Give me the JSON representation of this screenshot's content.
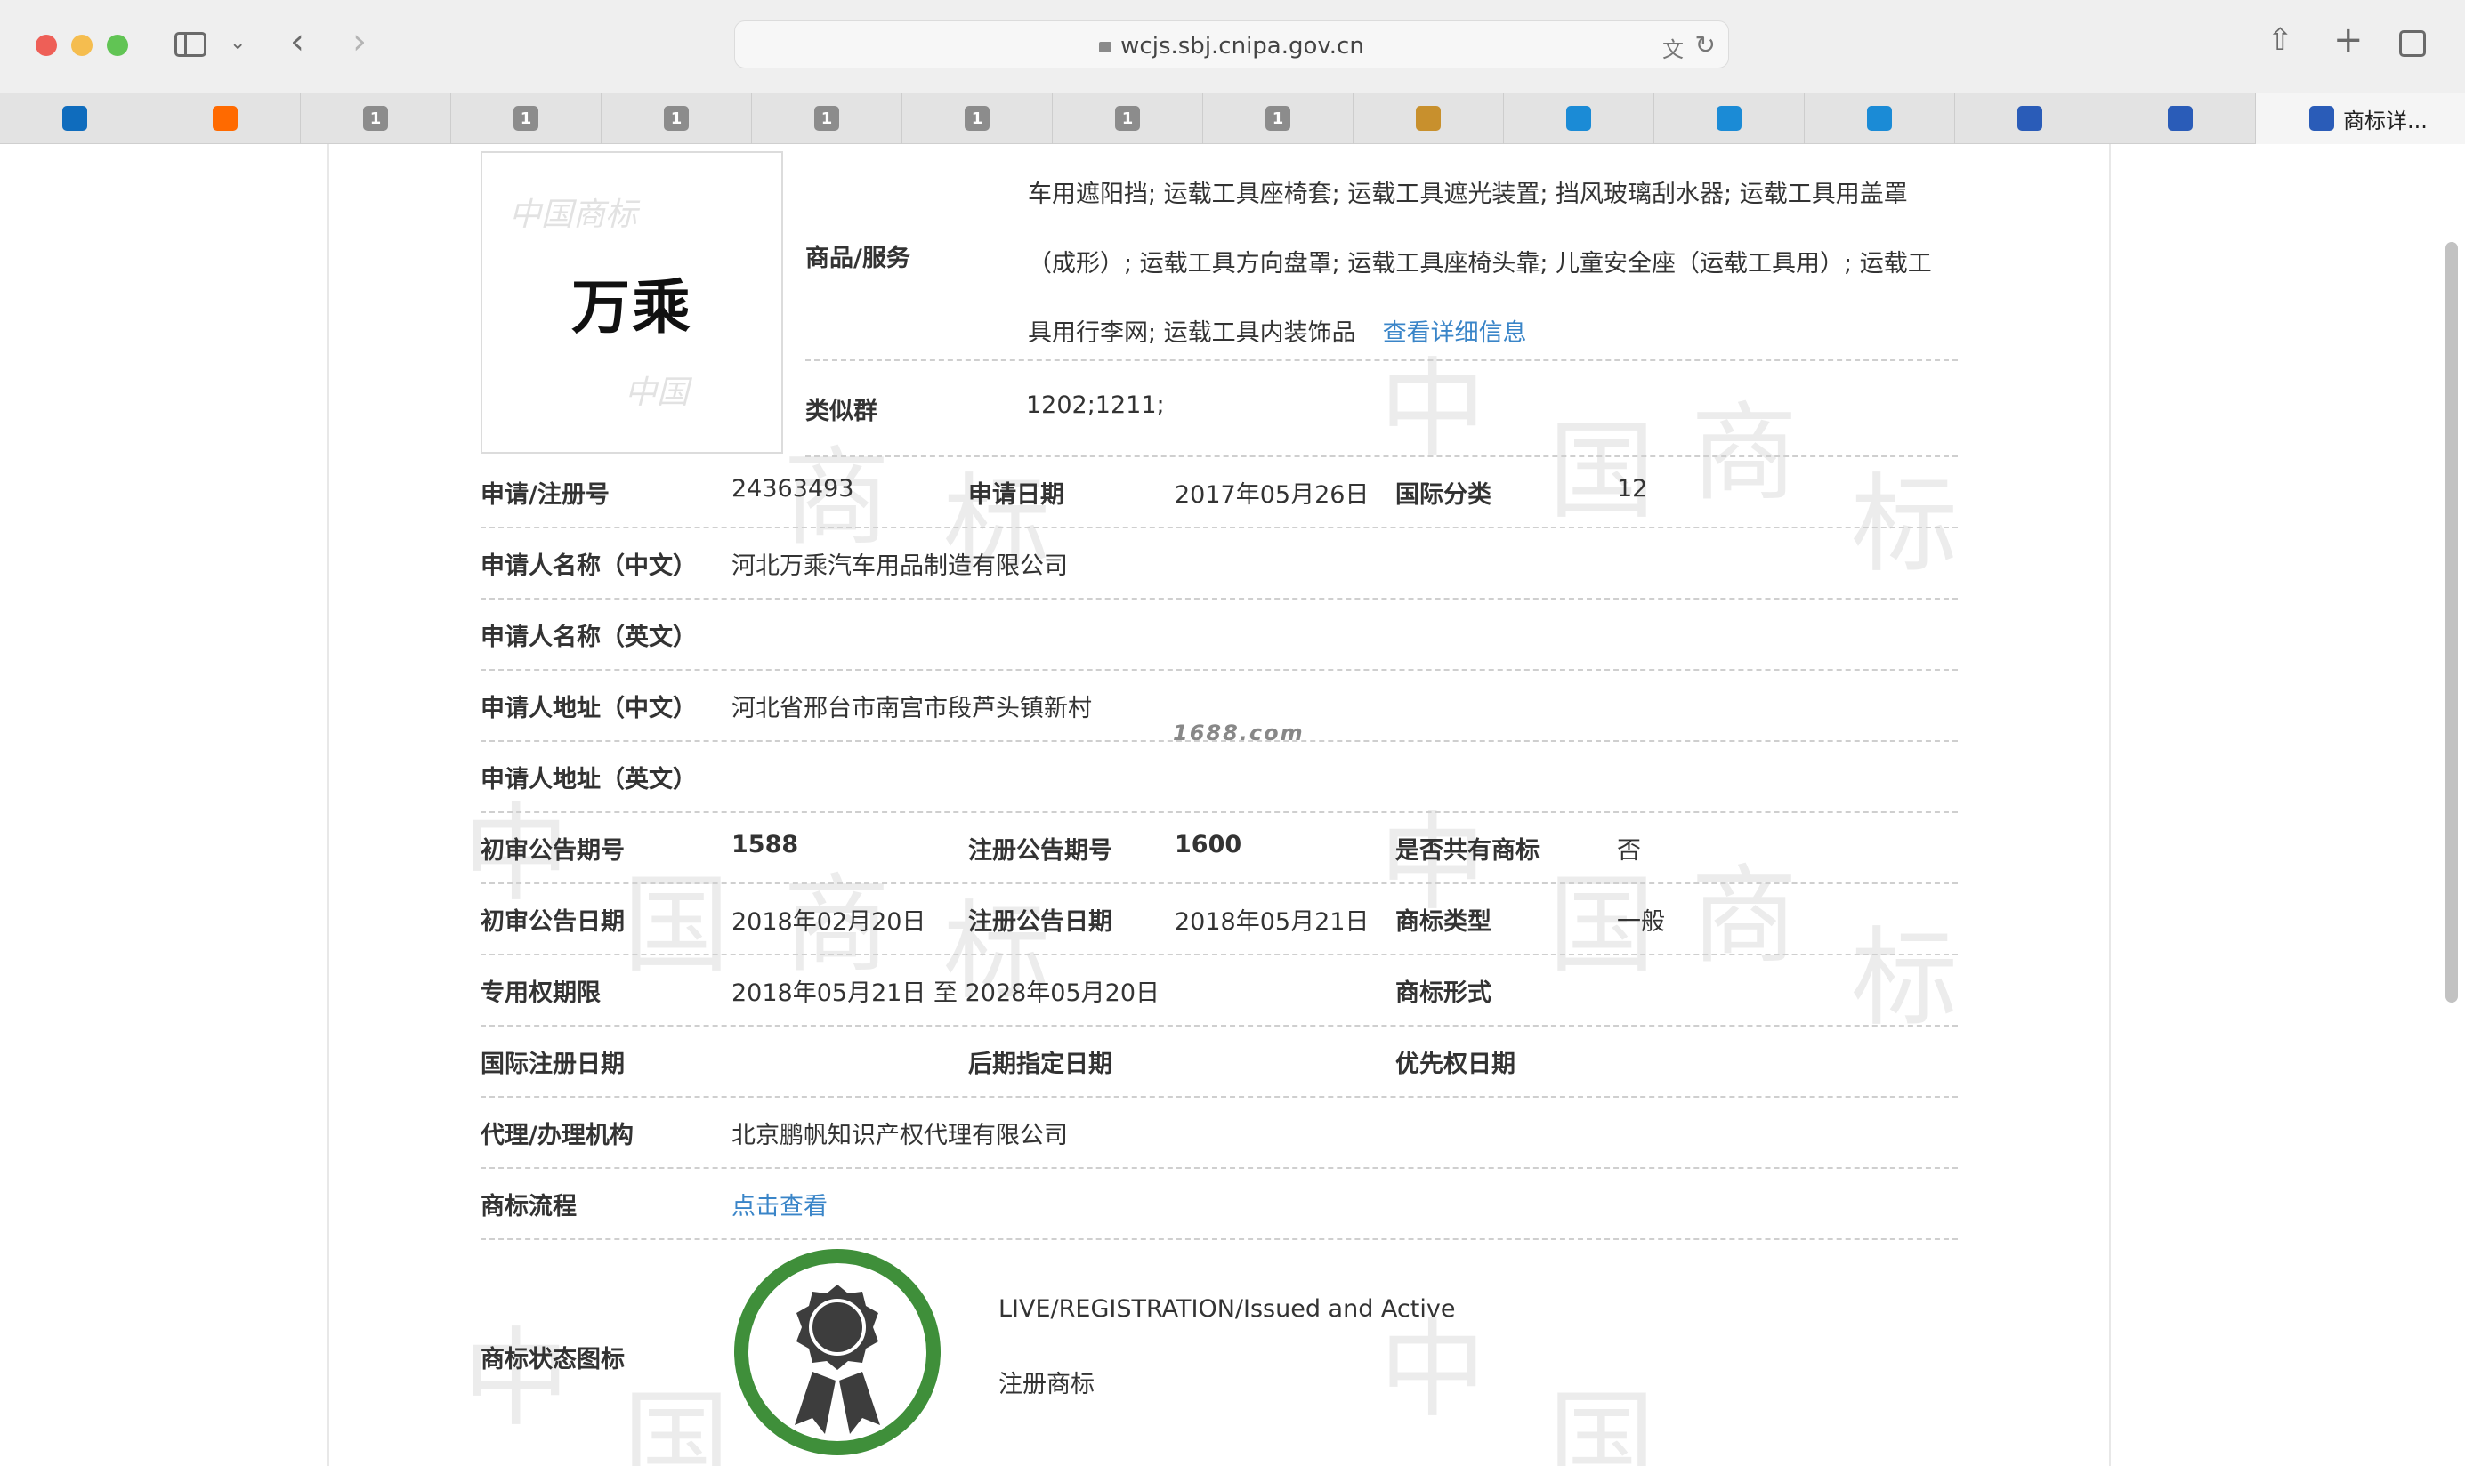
{
  "browser": {
    "url": "wcjs.sbj.cnipa.gov.cn",
    "tabs": [
      {
        "icon": "outlook-icon",
        "label": "",
        "color": "#0f6cbd"
      },
      {
        "icon": "alibaba-icon",
        "label": "",
        "color": "#ff6a00"
      },
      {
        "icon": "number-one-icon",
        "label": "1",
        "color": "#8c8c8c"
      },
      {
        "icon": "number-one-icon",
        "label": "1",
        "color": "#8c8c8c"
      },
      {
        "icon": "number-one-icon",
        "label": "1",
        "color": "#8c8c8c"
      },
      {
        "icon": "number-one-icon",
        "label": "1",
        "color": "#8c8c8c"
      },
      {
        "icon": "number-one-icon",
        "label": "1",
        "color": "#8c8c8c"
      },
      {
        "icon": "number-one-icon",
        "label": "1",
        "color": "#8c8c8c"
      },
      {
        "icon": "number-one-icon",
        "label": "1",
        "color": "#8c8c8c"
      },
      {
        "icon": "emblem-icon",
        "label": "",
        "color": "#c8902d"
      },
      {
        "icon": "edge-icon",
        "label": "",
        "color": "#1b8bd6"
      },
      {
        "icon": "edge-icon",
        "label": "",
        "color": "#1b8bd6"
      },
      {
        "icon": "edge-icon",
        "label": "",
        "color": "#1b8bd6"
      },
      {
        "icon": "cnipa-icon",
        "label": "",
        "color": "#2a5cb8"
      },
      {
        "icon": "cnipa-icon",
        "label": "",
        "color": "#2a5cb8"
      },
      {
        "icon": "cnipa-icon",
        "label": "商标详...",
        "color": "#2a5cb8"
      }
    ]
  },
  "trademark": {
    "logo_text": "万乘",
    "goods_label": "商品/服务",
    "goods_text": "车用遮阳挡; 运载工具座椅套; 运载工具遮光装置; 挡风玻璃刮水器; 运载工具用盖罩（成形）; 运载工具方向盘罩; 运载工具座椅头靠; 儿童安全座（运载工具用）; 运载工具用行李网; 运载工具内装饰品",
    "goods_more": "查看详细信息",
    "similar_label": "类似群",
    "similar_value": "1202;1211;",
    "reg_no_label": "申请/注册号",
    "reg_no": "24363493",
    "app_date_label": "申请日期",
    "app_date": "2017年05月26日",
    "intl_class_label": "国际分类",
    "intl_class": "12",
    "applicant_cn_label": "申请人名称（中文）",
    "applicant_cn": "河北万乘汽车用品制造有限公司",
    "applicant_en_label": "申请人名称（英文）",
    "address_cn_label": "申请人地址（中文）",
    "address_cn": "河北省邢台市南宫市段芦头镇新村",
    "address_en_label": "申请人地址（英文）",
    "watermark": "1688.com",
    "prelim_no_label": "初审公告期号",
    "prelim_no": "1588",
    "reg_pub_no_label": "注册公告期号",
    "reg_pub_no": "1600",
    "shared_label": "是否共有商标",
    "shared": "否",
    "prelim_date_label": "初审公告日期",
    "prelim_date": "2018年02月20日",
    "reg_pub_date_label": "注册公告日期",
    "reg_pub_date": "2018年05月21日",
    "type_label": "商标类型",
    "type": "一般",
    "term_label": "专用权期限",
    "term": "2018年05月21日 至 2028年05月20日",
    "form_label": "商标形式",
    "intl_reg_date_label": "国际注册日期",
    "later_date_label": "后期指定日期",
    "priority_label": "优先权日期",
    "agent_label": "代理/办理机构",
    "agent": "北京鹏帆知识产权代理有限公司",
    "process_label": "商标流程",
    "process_link": "点击查看",
    "status_label": "商标状态图标",
    "status_en": "LIVE/REGISTRATION/Issued and Active",
    "status_cn": "注册商标"
  }
}
